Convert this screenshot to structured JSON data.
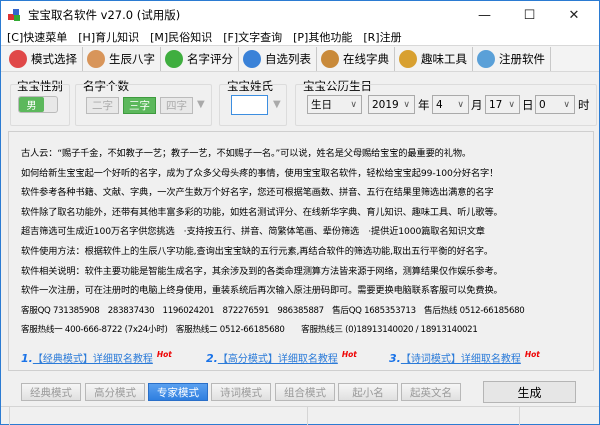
{
  "window": {
    "title": "宝宝取名软件 v27.0 (试用版)",
    "minimize": "—",
    "maximize": "☐",
    "close": "✕"
  },
  "menu": [
    "[C]快速菜单",
    "[H]育儿知识",
    "[M]民俗知识",
    "[F]文字查询",
    "[P]其他功能",
    "[R]注册"
  ],
  "toolbar": [
    {
      "label": "模式选择",
      "icon": "heart-icon",
      "color": "#e04848"
    },
    {
      "label": "生辰八字",
      "icon": "people-icon",
      "color": "#d8955a"
    },
    {
      "label": "名字评分",
      "icon": "arrow-right-icon",
      "color": "#3fae3f"
    },
    {
      "label": "自选列表",
      "icon": "globe-icon",
      "color": "#3a82d8"
    },
    {
      "label": "在线字典",
      "icon": "graduate-icon",
      "color": "#c98a3a"
    },
    {
      "label": "趣味工具",
      "icon": "windows-icon",
      "color": "#d8a030"
    },
    {
      "label": "注册软件",
      "icon": "monitor-icon",
      "color": "#5aa0d8"
    }
  ],
  "form": {
    "gender": {
      "label": "宝宝性别",
      "value": "男"
    },
    "count": {
      "label": "名字个数",
      "options": [
        "二字",
        "三字",
        "四字"
      ],
      "selected": "三字"
    },
    "surname": {
      "label": "宝宝姓氏",
      "value": ""
    },
    "birthday": {
      "label": "宝宝公历生日",
      "type": "生日",
      "year": "2019",
      "year_unit": "年",
      "month": "4",
      "month_unit": "月",
      "day": "17",
      "day_unit": "日",
      "hour": "0",
      "hour_unit": "时"
    }
  },
  "info": [
    "古人云：“赐子千金，不如教子一艺；教子一艺，不如赐子一名。”可以说，姓名是父母赐给宝宝的最重要的礼物。",
    "如何给新生宝宝起一个好听的名字，成为了众多父母头疼的事情，使用宝宝取名软件，轻松给宝宝起99-100分好名字！",
    "软件参考各种书籍、文献、字典，一次产生数万个好名字，您还可根据笔画数、拼音、五行在结果里筛选出满意的名字",
    "软件除了取名功能外，还带有其他丰富多彩的功能，如姓名测试评分、在线新华字典、育儿知识、趣味工具、听儿歌等。",
    "超吉筛选可生成近100万名字供您挑选　·支持按五行、拼音、简繁体笔画、辈份筛选　·提供近1000篇取名知识文章",
    "软件使用方法：根据软件上的生辰八字功能,查询出宝宝缺的五行元素,再结合软件的筛选功能,取出五行平衡的好名字。",
    "软件相关说明：软件主要功能是智能生成名字，其余涉及到的各类命理测算方法皆来源于网络，测算结果仅作娱乐参考。",
    "软件一次注册，可在注册时的电脑上终身使用，重装系统后再次输入原注册码即可。需要更换电脑联系客服可以免费换。",
    "客服QQ 731385908　283837430　1196024201　872276591　986385887　售后QQ 1685353713　售后热线 0512-66185680",
    "客服热线一 400-666-8722 (7x24小时)　客服热线二 0512-66185680　　客服热线三 (0)18913140020 / 18913140021"
  ],
  "links": [
    {
      "num": "1.",
      "text": "【经典模式】详细取名教程",
      "hot": "Hot"
    },
    {
      "num": "2.",
      "text": "【高分模式】详细取名教程",
      "hot": "Hot"
    },
    {
      "num": "3.",
      "text": "【诗词模式】详细取名教程",
      "hot": "Hot"
    }
  ],
  "modes": [
    "经典模式",
    "高分模式",
    "专家模式",
    "诗词模式",
    "组合模式",
    "起小名",
    "起英文名"
  ],
  "active_mode": "专家模式",
  "generate": "生成"
}
